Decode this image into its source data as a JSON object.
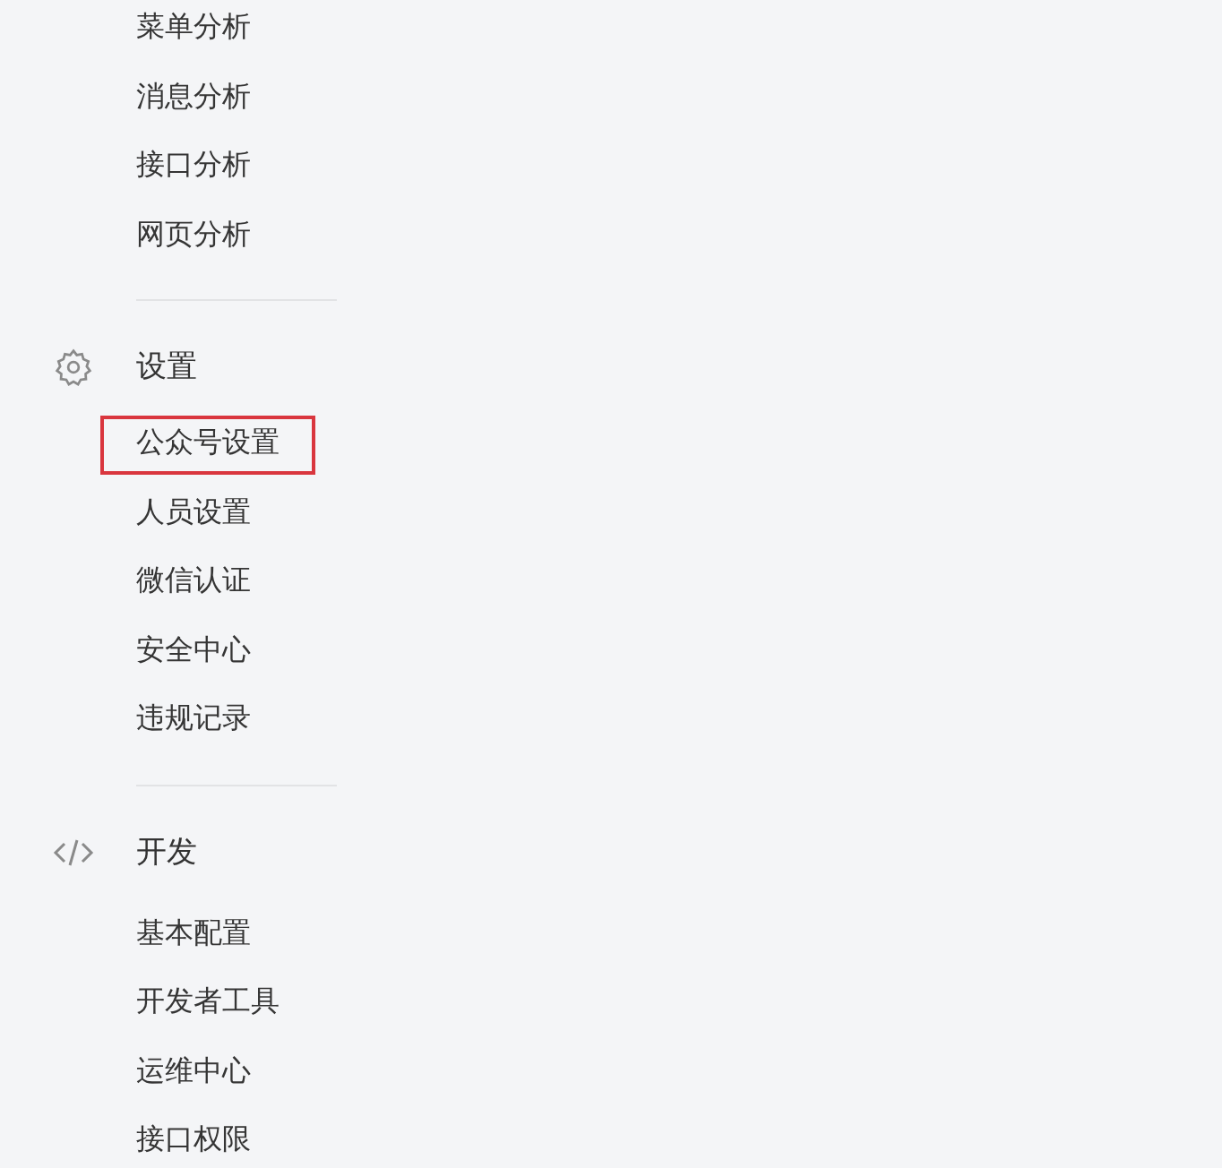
{
  "sections": [
    {
      "items": [
        {
          "label": "菜单分析",
          "highlighted": false
        },
        {
          "label": "消息分析",
          "highlighted": false
        },
        {
          "label": "接口分析",
          "highlighted": false
        },
        {
          "label": "网页分析",
          "highlighted": false
        }
      ]
    },
    {
      "title": "设置",
      "items": [
        {
          "label": "公众号设置",
          "highlighted": true
        },
        {
          "label": "人员设置",
          "highlighted": false
        },
        {
          "label": "微信认证",
          "highlighted": false
        },
        {
          "label": "安全中心",
          "highlighted": false
        },
        {
          "label": "违规记录",
          "highlighted": false
        }
      ]
    },
    {
      "title": "开发",
      "items": [
        {
          "label": "基本配置",
          "highlighted": false
        },
        {
          "label": "开发者工具",
          "highlighted": false
        },
        {
          "label": "运维中心",
          "highlighted": false
        },
        {
          "label": "接口权限",
          "highlighted": false
        }
      ]
    }
  ]
}
